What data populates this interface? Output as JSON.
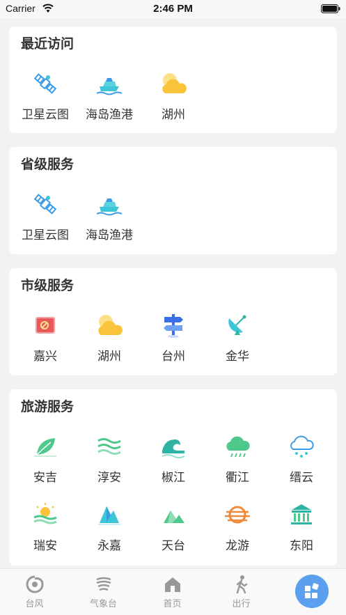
{
  "status_bar": {
    "carrier": "Carrier",
    "time": "2:46 PM"
  },
  "sections": [
    {
      "title": "最近访问",
      "items": [
        {
          "label": "卫星云图",
          "icon": "satellite-icon"
        },
        {
          "label": "海岛渔港",
          "icon": "ship-icon"
        },
        {
          "label": "湖州",
          "icon": "sun-cloud-icon"
        }
      ]
    },
    {
      "title": "省级服务",
      "items": [
        {
          "label": "卫星云图",
          "icon": "satellite-icon"
        },
        {
          "label": "海岛渔港",
          "icon": "ship-icon"
        }
      ]
    },
    {
      "title": "市级服务",
      "items": [
        {
          "label": "嘉兴",
          "icon": "red-flag-icon"
        },
        {
          "label": "湖州",
          "icon": "sun-cloud-icon"
        },
        {
          "label": "台州",
          "icon": "signpost-icon"
        },
        {
          "label": "金华",
          "icon": "radar-dish-icon"
        }
      ]
    },
    {
      "title": "旅游服务",
      "items": [
        {
          "label": "安吉",
          "icon": "leaf-icon"
        },
        {
          "label": "淳安",
          "icon": "wind-waves-icon"
        },
        {
          "label": "椒江",
          "icon": "wave-icon"
        },
        {
          "label": "衢江",
          "icon": "rain-cloud-icon"
        },
        {
          "label": "缙云",
          "icon": "drizzle-cloud-icon"
        },
        {
          "label": "瑞安",
          "icon": "sunrise-icon"
        },
        {
          "label": "永嘉",
          "icon": "mountain-icon"
        },
        {
          "label": "天台",
          "icon": "peaks-icon"
        },
        {
          "label": "龙游",
          "icon": "haze-sun-icon"
        },
        {
          "label": "东阳",
          "icon": "temple-icon"
        }
      ]
    }
  ],
  "tab_bar": [
    {
      "label": "台风",
      "icon": "typhoon-icon"
    },
    {
      "label": "气象台",
      "icon": "weather-station-icon"
    },
    {
      "label": "首页",
      "icon": "home-icon"
    },
    {
      "label": "出行",
      "icon": "walking-icon"
    },
    {
      "label": "",
      "icon": "apps-icon"
    }
  ],
  "colors": {
    "blue": "#3a9be8",
    "cyan": "#3cc6d8",
    "yellow": "#f9c33a",
    "red": "#e8595c",
    "green": "#4ec98b",
    "teal": "#2fb3a4",
    "orange": "#f08a3b",
    "fab": "#5aa0ee",
    "tab_gray": "#999999"
  }
}
